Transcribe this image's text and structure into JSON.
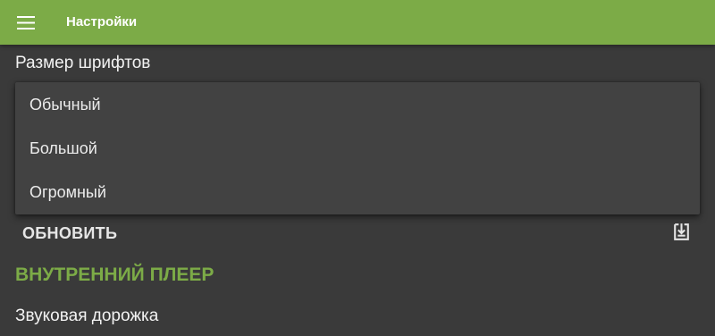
{
  "toolbar": {
    "title": "Настройки",
    "menu_icon": "hamburger-menu-icon",
    "color": "#7cab47"
  },
  "font_size": {
    "label": "Размер шрифтов",
    "options": [
      "Обычный",
      "Большой",
      "Огромный"
    ]
  },
  "update": {
    "label": "ОБНОВИТЬ",
    "icon": "download-tray-icon"
  },
  "section": {
    "title": "ВНУТРЕННИЙ ПЛЕЕР",
    "color": "#7cab47"
  },
  "audio_track": {
    "label": "Звуковая дорожка"
  }
}
